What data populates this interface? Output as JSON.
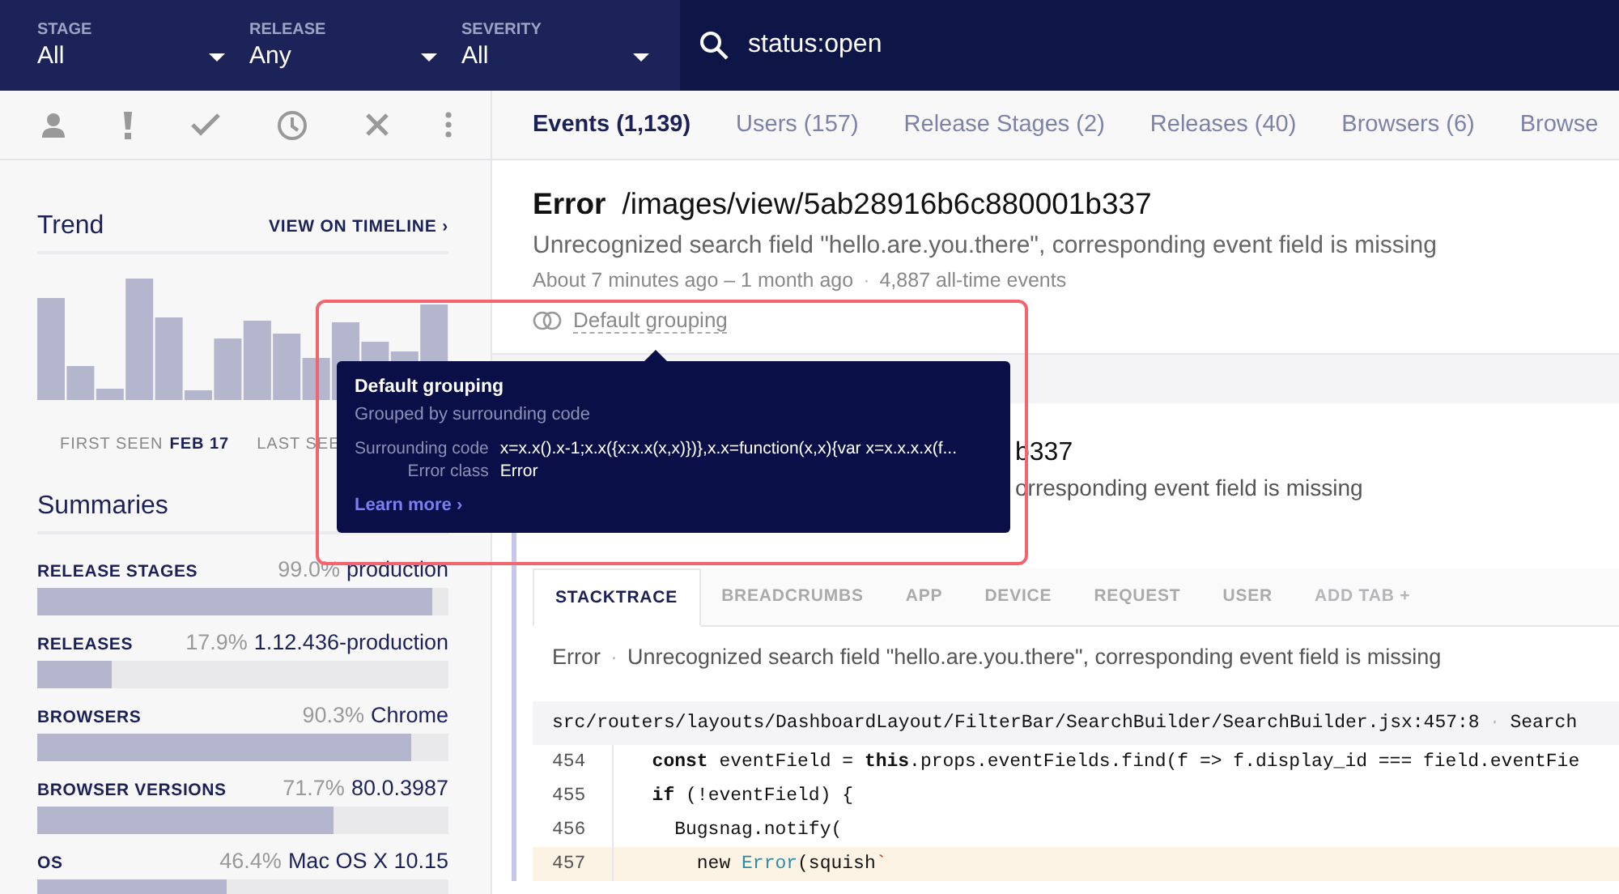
{
  "filters": [
    {
      "label": "STAGE",
      "value": "All"
    },
    {
      "label": "RELEASE",
      "value": "Any"
    },
    {
      "label": "SEVERITY",
      "value": "All"
    }
  ],
  "search": {
    "value": "status:open"
  },
  "sidebar": {
    "trend": {
      "title": "Trend",
      "link": "VIEW ON TIMELINE ›",
      "first_seen_label": "FIRST SEEN",
      "first_seen_value": "FEB 17",
      "last_seen_label": "LAST SEE"
    },
    "summaries_title": "Summaries",
    "summaries": [
      {
        "label": "RELEASE STAGES",
        "percent": "99.0%",
        "value": "production",
        "level": 0.96
      },
      {
        "label": "RELEASES",
        "percent": "17.9%",
        "value": "1.12.436-production",
        "level": 0.18
      },
      {
        "label": "BROWSERS",
        "percent": "90.3%",
        "value": "Chrome",
        "level": 0.91
      },
      {
        "label": "BROWSER VERSIONS",
        "percent": "71.7%",
        "value": "80.0.3987",
        "level": 0.72
      },
      {
        "label": "OS",
        "percent": "46.4%",
        "value": "Mac OS X 10.15",
        "level": 0.46
      }
    ]
  },
  "tabs": [
    {
      "label": "Events (1,139)",
      "selected": true
    },
    {
      "label": "Users (157)",
      "selected": false
    },
    {
      "label": "Release Stages (2)",
      "selected": false
    },
    {
      "label": "Releases (40)",
      "selected": false
    },
    {
      "label": "Browsers (6)",
      "selected": false
    },
    {
      "label": "Browse",
      "selected": false
    }
  ],
  "error": {
    "class": "Error",
    "context": "/images/view/5ab28916b6c880001b337",
    "message": "Unrecognized search field \"hello.are.you.there\", corresponding event field is missing",
    "time_range": "About 7 minutes ago – 1 month ago",
    "separator": "·",
    "event_count": "4,887 all-time events",
    "grouping": "Default grouping"
  },
  "event": {
    "title_fragment": "b337",
    "message_fragment": "orresponding event field is missing",
    "tabs": [
      {
        "label": "STACKTRACE",
        "selected": true,
        "disabled": false
      },
      {
        "label": "BREADCRUMBS",
        "selected": false,
        "disabled": false
      },
      {
        "label": "APP",
        "selected": false,
        "disabled": false
      },
      {
        "label": "DEVICE",
        "selected": false,
        "disabled": false
      },
      {
        "label": "REQUEST",
        "selected": false,
        "disabled": false
      },
      {
        "label": "USER",
        "selected": false,
        "disabled": false
      },
      {
        "label": "ADD TAB +",
        "selected": false,
        "disabled": true
      }
    ],
    "error_class": "Error",
    "separator": "·",
    "message": "Unrecognized search field \"hello.are.you.there\", corresponding event field is missing",
    "frame_file": "src/routers/layouts/DashboardLayout/FilterBar/SearchBuilder/SearchBuilder.jsx:457:8",
    "frame_separator": "·",
    "frame_method": "Search",
    "code": [
      {
        "number": "454",
        "highlighted": false,
        "tokens": [
          {
            "text": "  const",
            "kind": "keyword"
          },
          {
            "text": " eventField = ",
            "kind": "plain"
          },
          {
            "text": "this",
            "kind": "keyword"
          },
          {
            "text": ".props.eventFields.find(f => f.display_id === field.eventFie",
            "kind": "plain"
          }
        ]
      },
      {
        "number": "455",
        "highlighted": false,
        "tokens": [
          {
            "text": "  if",
            "kind": "keyword"
          },
          {
            "text": " (!eventField) {",
            "kind": "plain"
          }
        ]
      },
      {
        "number": "456",
        "highlighted": false,
        "tokens": [
          {
            "text": "    Bugsnag.notify(",
            "kind": "plain"
          }
        ]
      },
      {
        "number": "457",
        "highlighted": true,
        "tokens": [
          {
            "text": "      new ",
            "kind": "plain"
          },
          {
            "text": "Error",
            "kind": "type"
          },
          {
            "text": "(squish",
            "kind": "plain"
          },
          {
            "text": "`",
            "kind": "string"
          }
        ]
      }
    ]
  },
  "tooltip": {
    "title": "Default grouping",
    "subtitle": "Grouped by surrounding code",
    "fields": [
      {
        "label": "Surrounding code",
        "value": "x=x.x().x-1;x.x({x:x.x(x,x)})},x.x=function(x,x){var x=x.x.x.x(f..."
      },
      {
        "label": "Error class",
        "value": "Error"
      }
    ],
    "link": "Learn more ›"
  }
}
